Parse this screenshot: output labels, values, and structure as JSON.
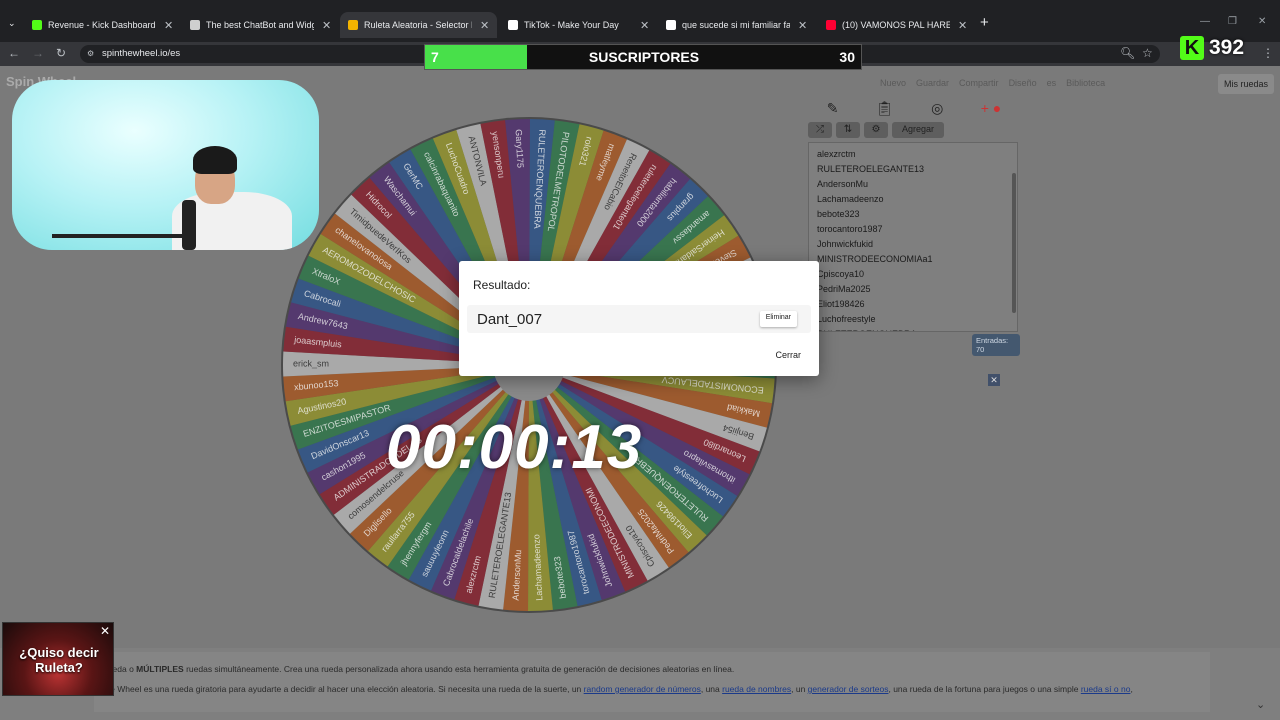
{
  "browser": {
    "tabs": [
      {
        "label": "Revenue - Kick Dashboard",
        "color": "#53fc18"
      },
      {
        "label": "The best ChatBot and Widgets",
        "color": "#cfcfcf"
      },
      {
        "label": "Ruleta Aleatoria - Selector Pers",
        "color": "#f4b400"
      },
      {
        "label": "TikTok - Make Your Day",
        "color": "#ffffff"
      },
      {
        "label": "que sucede si mi familiar fallec",
        "color": "#ffffff"
      },
      {
        "label": "(10) VAMONOS PAL HAREM RE",
        "color": "#ff0033"
      }
    ],
    "url": "spinthewheel.io/es"
  },
  "site": {
    "brand": "Spin Wheel",
    "nav": [
      "Nuevo",
      "Guardar",
      "Compartir",
      "Diseño",
      "es",
      "Biblioteca",
      "Mis ruedas"
    ]
  },
  "wheel": {
    "segments": [
      "ANTONVILA",
      "yensonperu",
      "Gary1175",
      "RULETEROENQUEBRA",
      "PILOTODELMETROPOL",
      "rolo321",
      "matleyme",
      "ReneitoElCabio",
      "ruleteroelegante01",
      "habilianta2000",
      "granplus",
      "amandassv",
      "HeinerSaldana",
      "Stevemb21",
      "felixpata",
      "cry_estudio25",
      "micha322",
      "normasilvia",
      "Dsanchez2000",
      "ECONOMISTADELAUCV",
      "Makkiad",
      "Benjii54",
      "Leonardi80",
      "ithomasvilapro",
      "Luchofreestyle",
      "RULETEROENQUEBRA",
      "Eliot198426",
      "PedriMa2025",
      "Cpiscoya10",
      "MINISTRODEECONOMI",
      "Johnwickfukid",
      "torocantoro1987",
      "bebote323",
      "Lachamadeenzo",
      "AndersonMu",
      "RULETEROELEGANTE13",
      "alexzrctm",
      "Cabrocaldelachile",
      "sauuuyleonn",
      "jhennyfergm",
      "raullarra755",
      "Diglisello",
      "comosendelcruse",
      "ADMINISTRADORDELAS",
      "cashon1995",
      "DavidOnscar13",
      "ENZITOESMIPASTOR",
      "Agustinos20",
      "xbunoo153",
      "erick_sm",
      "joaasmpluis",
      "Andrew7643",
      "Cabrocali",
      "XtraloX",
      "AEROMOZODELCHOSIC",
      "chanelovanoiosa",
      "TimidpuedeVerIKos",
      "Hidrocol",
      "Waschamui",
      "GerMC",
      "calcinrabaquanito",
      "LuchoCuadro"
    ],
    "colors": [
      "#e3e3e3",
      "#a41c2d",
      "#5a2f85",
      "#2b5fa8",
      "#2f8f52",
      "#b5b52a",
      "#d0661e"
    ]
  },
  "timer": "00:00:13",
  "stream": {
    "subs_current": "7",
    "subs_label": "SUSCRIPTORES",
    "subs_goal": "30",
    "subs_progress": 0.233,
    "kick_count": "392"
  },
  "panel": {
    "add_label": "Agregar",
    "entries": [
      "alexzrctm",
      "RULETEROELEGANTE13",
      "AndersonMu",
      "Lachamadeenzo",
      "bebote323",
      "torocantoro1987",
      "Johnwickfukid",
      "MINISTRODEECONOMIAa1",
      "Cpiscoya10",
      "PedriMa2025",
      "Eliot198426",
      "Luchofreestyle",
      "RULETEROENQUEBRA"
    ],
    "count": "Entradas: 70"
  },
  "dialog": {
    "title": "Resultado:",
    "winner": "Dant_007",
    "delete_label": "Eliminar",
    "close_label": "Cerrar"
  },
  "footer": {
    "line1_pre": "la rueda o ",
    "line1_bold": "MÚLTIPLES",
    "line1_post": " ruedas simultáneamente. Crea una rueda personalizada ahora usando esta herramienta gratuita de generación de decisiones aleatorias en línea.",
    "line2_pre": "n the Wheel es una rueda giratoria para ayudarte a decidir al hacer una elección aleatoria. Si necesita una rueda de la suerte, un ",
    "link1": "random generador de números",
    "sep1": ", una ",
    "link2": "rueda de nombres",
    "sep2": ", un ",
    "link3": "generador de sorteos",
    "sep3": ", una rueda de la fortuna para juegos o una simple ",
    "link4": "rueda sí o no",
    "line2_end": ","
  },
  "promo": {
    "line1": "¿Quiso decir",
    "line2": "Ruleta?"
  }
}
